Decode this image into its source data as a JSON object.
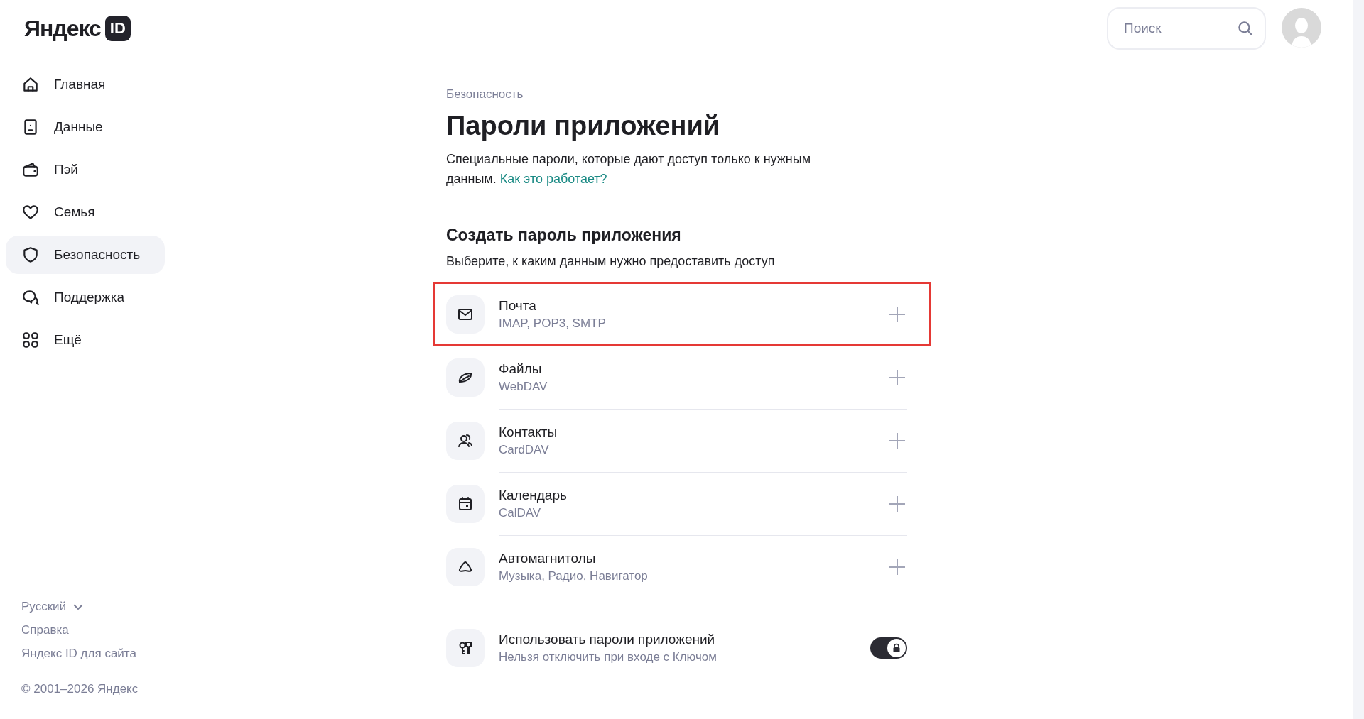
{
  "logo": {
    "text": "Яндекс",
    "badge": "ID"
  },
  "sidebar": {
    "items": [
      {
        "label": "Главная",
        "kind": "home",
        "selected": false
      },
      {
        "label": "Данные",
        "kind": "id",
        "selected": false
      },
      {
        "label": "Пэй",
        "kind": "wallet",
        "selected": false
      },
      {
        "label": "Семья",
        "kind": "heart",
        "selected": false
      },
      {
        "label": "Безопасность",
        "kind": "shield",
        "selected": true
      },
      {
        "label": "Поддержка",
        "kind": "chat",
        "selected": false
      },
      {
        "label": "Ещё",
        "kind": "grid",
        "selected": false
      }
    ],
    "footer": {
      "language": "Русский",
      "links": [
        "Справка",
        "Яндекс ID для сайта"
      ],
      "copyright": "© 2001–2026 Яндекс"
    }
  },
  "search": {
    "placeholder": "Поиск"
  },
  "breadcrumb": "Безопасность",
  "title": "Пароли приложений",
  "description": {
    "text": "Специальные пароли, которые дают доступ только к нужным данным.",
    "link": "Как это работает?"
  },
  "section": {
    "title": "Создать пароль приложения",
    "subtitle": "Выберите, к каким данным нужно предоставить доступ"
  },
  "options": [
    {
      "kind": "mail",
      "title": "Почта",
      "subtitle": "IMAP, POP3, SMTP",
      "highlighted": true
    },
    {
      "kind": "files",
      "title": "Файлы",
      "subtitle": "WebDAV",
      "highlighted": false
    },
    {
      "kind": "contacts",
      "title": "Контакты",
      "subtitle": "CardDAV",
      "highlighted": false
    },
    {
      "kind": "calendar",
      "title": "Календарь",
      "subtitle": "CalDAV",
      "highlighted": false
    },
    {
      "kind": "car",
      "title": "Автомагнитолы",
      "subtitle": "Музыка, Радио, Навигатор",
      "highlighted": false
    }
  ],
  "setting": {
    "title": "Использовать пароли приложений",
    "subtitle": "Нельзя отключить при входе с Ключом",
    "on": true,
    "locked": true
  }
}
